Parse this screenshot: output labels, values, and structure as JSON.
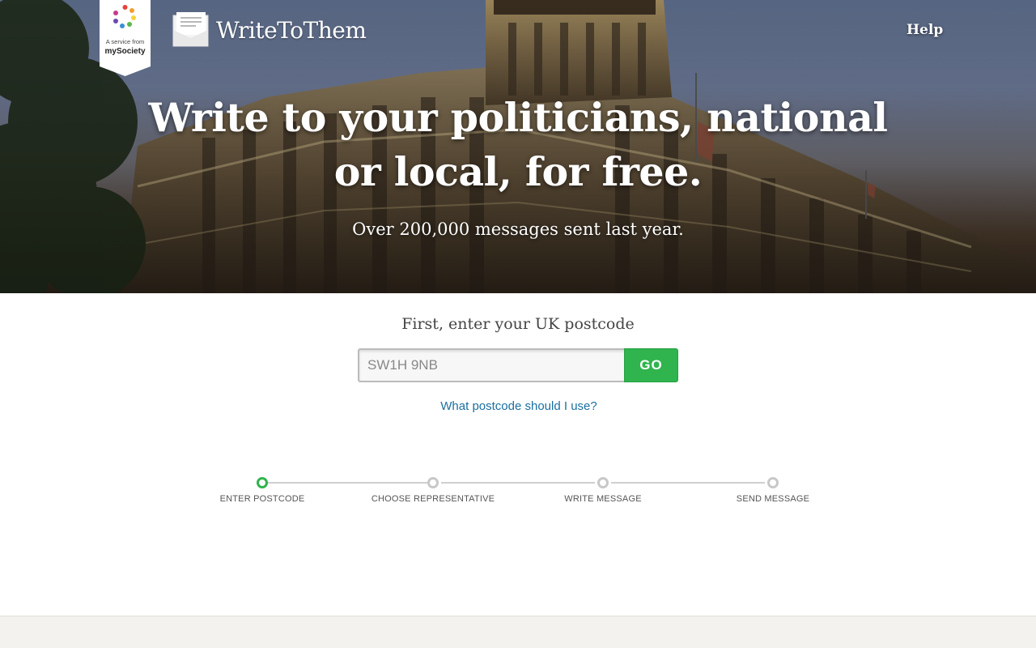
{
  "header": {
    "badge_line1": "A service from",
    "badge_org": "mySociety",
    "logo_title": "WriteToThem",
    "help_label": "Help"
  },
  "hero": {
    "headline_line1": "Write to your politicians, national",
    "headline_line2": "or local, for free.",
    "subline": "Over 200,000 messages sent last year."
  },
  "form": {
    "prompt": "First, enter your UK postcode",
    "postcode_placeholder": "SW1H 9NB",
    "postcode_value": "",
    "go_label": "GO",
    "help_link": "What postcode should I use?"
  },
  "steps": [
    {
      "label": "ENTER POSTCODE",
      "active": true
    },
    {
      "label": "CHOOSE REPRESENTATIVE",
      "active": false
    },
    {
      "label": "WRITE MESSAGE",
      "active": false
    },
    {
      "label": "SEND MESSAGE",
      "active": false
    }
  ],
  "colors": {
    "accent_green": "#2fb44e",
    "link_blue": "#1a6fa0",
    "footer_bg": "#f3f2ee"
  }
}
